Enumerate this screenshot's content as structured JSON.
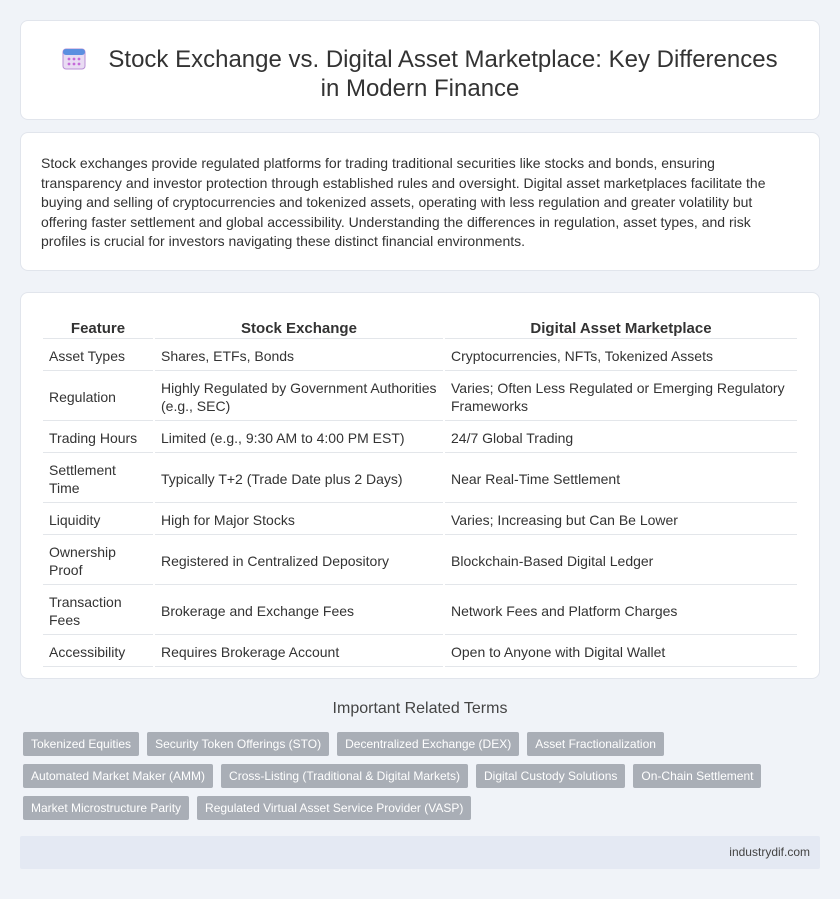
{
  "header": {
    "icon": "calendar-grid-icon",
    "title": "Stock Exchange vs. Digital Asset Marketplace: Key Differences in Modern Finance"
  },
  "intro": "Stock exchanges provide regulated platforms for trading traditional securities like stocks and bonds, ensuring transparency and investor protection through established rules and oversight. Digital asset marketplaces facilitate the buying and selling of cryptocurrencies and tokenized assets, operating with less regulation and greater volatility but offering faster settlement and global accessibility. Understanding the differences in regulation, asset types, and risk profiles is crucial for investors navigating these distinct financial environments.",
  "table": {
    "headers": [
      "Feature",
      "Stock Exchange",
      "Digital Asset Marketplace"
    ],
    "rows": [
      [
        "Asset Types",
        "Shares, ETFs, Bonds",
        "Cryptocurrencies, NFTs, Tokenized Assets"
      ],
      [
        "Regulation",
        "Highly Regulated by Government Authorities (e.g., SEC)",
        "Varies; Often Less Regulated or Emerging Regulatory Frameworks"
      ],
      [
        "Trading Hours",
        "Limited (e.g., 9:30 AM to 4:00 PM EST)",
        "24/7 Global Trading"
      ],
      [
        "Settlement Time",
        "Typically T+2 (Trade Date plus 2 Days)",
        "Near Real-Time Settlement"
      ],
      [
        "Liquidity",
        "High for Major Stocks",
        "Varies; Increasing but Can Be Lower"
      ],
      [
        "Ownership Proof",
        "Registered in Centralized Depository",
        "Blockchain-Based Digital Ledger"
      ],
      [
        "Transaction Fees",
        "Brokerage and Exchange Fees",
        "Network Fees and Platform Charges"
      ],
      [
        "Accessibility",
        "Requires Brokerage Account",
        "Open to Anyone with Digital Wallet"
      ]
    ]
  },
  "related": {
    "title": "Important Related Terms",
    "tags": [
      "Tokenized Equities",
      "Security Token Offerings (STO)",
      "Decentralized Exchange (DEX)",
      "Asset Fractionalization",
      "Automated Market Maker (AMM)",
      "Cross-Listing (Traditional & Digital Markets)",
      "Digital Custody Solutions",
      "On-Chain Settlement",
      "Market Microstructure Parity",
      "Regulated Virtual Asset Service Provider (VASP)"
    ]
  },
  "footer": {
    "site": "industrydif.com"
  }
}
